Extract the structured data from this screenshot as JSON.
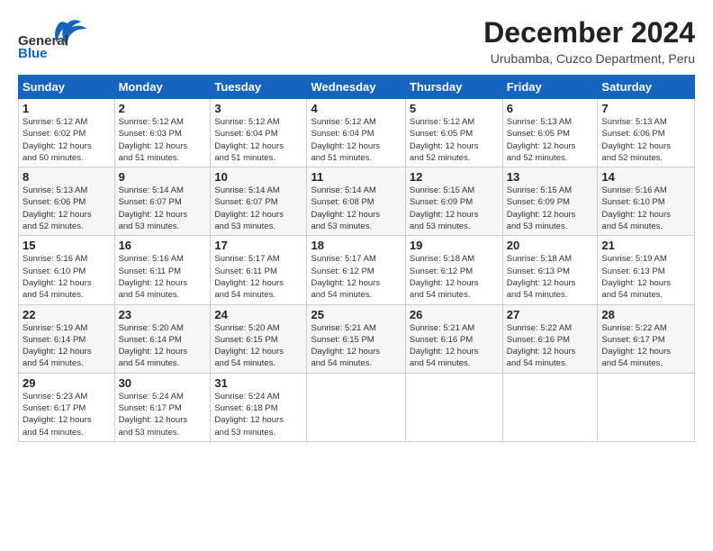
{
  "logo": {
    "general": "General",
    "blue": "Blue"
  },
  "header": {
    "title": "December 2024",
    "subtitle": "Urubamba, Cuzco Department, Peru"
  },
  "weekdays": [
    "Sunday",
    "Monday",
    "Tuesday",
    "Wednesday",
    "Thursday",
    "Friday",
    "Saturday"
  ],
  "weeks": [
    [
      {
        "day": 1,
        "info": "Sunrise: 5:12 AM\nSunset: 6:02 PM\nDaylight: 12 hours\nand 50 minutes."
      },
      {
        "day": 2,
        "info": "Sunrise: 5:12 AM\nSunset: 6:03 PM\nDaylight: 12 hours\nand 51 minutes."
      },
      {
        "day": 3,
        "info": "Sunrise: 5:12 AM\nSunset: 6:04 PM\nDaylight: 12 hours\nand 51 minutes."
      },
      {
        "day": 4,
        "info": "Sunrise: 5:12 AM\nSunset: 6:04 PM\nDaylight: 12 hours\nand 51 minutes."
      },
      {
        "day": 5,
        "info": "Sunrise: 5:12 AM\nSunset: 6:05 PM\nDaylight: 12 hours\nand 52 minutes."
      },
      {
        "day": 6,
        "info": "Sunrise: 5:13 AM\nSunset: 6:05 PM\nDaylight: 12 hours\nand 52 minutes."
      },
      {
        "day": 7,
        "info": "Sunrise: 5:13 AM\nSunset: 6:06 PM\nDaylight: 12 hours\nand 52 minutes."
      }
    ],
    [
      {
        "day": 8,
        "info": "Sunrise: 5:13 AM\nSunset: 6:06 PM\nDaylight: 12 hours\nand 52 minutes."
      },
      {
        "day": 9,
        "info": "Sunrise: 5:14 AM\nSunset: 6:07 PM\nDaylight: 12 hours\nand 53 minutes."
      },
      {
        "day": 10,
        "info": "Sunrise: 5:14 AM\nSunset: 6:07 PM\nDaylight: 12 hours\nand 53 minutes."
      },
      {
        "day": 11,
        "info": "Sunrise: 5:14 AM\nSunset: 6:08 PM\nDaylight: 12 hours\nand 53 minutes."
      },
      {
        "day": 12,
        "info": "Sunrise: 5:15 AM\nSunset: 6:09 PM\nDaylight: 12 hours\nand 53 minutes."
      },
      {
        "day": 13,
        "info": "Sunrise: 5:15 AM\nSunset: 6:09 PM\nDaylight: 12 hours\nand 53 minutes."
      },
      {
        "day": 14,
        "info": "Sunrise: 5:16 AM\nSunset: 6:10 PM\nDaylight: 12 hours\nand 54 minutes."
      }
    ],
    [
      {
        "day": 15,
        "info": "Sunrise: 5:16 AM\nSunset: 6:10 PM\nDaylight: 12 hours\nand 54 minutes."
      },
      {
        "day": 16,
        "info": "Sunrise: 5:16 AM\nSunset: 6:11 PM\nDaylight: 12 hours\nand 54 minutes."
      },
      {
        "day": 17,
        "info": "Sunrise: 5:17 AM\nSunset: 6:11 PM\nDaylight: 12 hours\nand 54 minutes."
      },
      {
        "day": 18,
        "info": "Sunrise: 5:17 AM\nSunset: 6:12 PM\nDaylight: 12 hours\nand 54 minutes."
      },
      {
        "day": 19,
        "info": "Sunrise: 5:18 AM\nSunset: 6:12 PM\nDaylight: 12 hours\nand 54 minutes."
      },
      {
        "day": 20,
        "info": "Sunrise: 5:18 AM\nSunset: 6:13 PM\nDaylight: 12 hours\nand 54 minutes."
      },
      {
        "day": 21,
        "info": "Sunrise: 5:19 AM\nSunset: 6:13 PM\nDaylight: 12 hours\nand 54 minutes."
      }
    ],
    [
      {
        "day": 22,
        "info": "Sunrise: 5:19 AM\nSunset: 6:14 PM\nDaylight: 12 hours\nand 54 minutes."
      },
      {
        "day": 23,
        "info": "Sunrise: 5:20 AM\nSunset: 6:14 PM\nDaylight: 12 hours\nand 54 minutes."
      },
      {
        "day": 24,
        "info": "Sunrise: 5:20 AM\nSunset: 6:15 PM\nDaylight: 12 hours\nand 54 minutes."
      },
      {
        "day": 25,
        "info": "Sunrise: 5:21 AM\nSunset: 6:15 PM\nDaylight: 12 hours\nand 54 minutes."
      },
      {
        "day": 26,
        "info": "Sunrise: 5:21 AM\nSunset: 6:16 PM\nDaylight: 12 hours\nand 54 minutes."
      },
      {
        "day": 27,
        "info": "Sunrise: 5:22 AM\nSunset: 6:16 PM\nDaylight: 12 hours\nand 54 minutes."
      },
      {
        "day": 28,
        "info": "Sunrise: 5:22 AM\nSunset: 6:17 PM\nDaylight: 12 hours\nand 54 minutes."
      }
    ],
    [
      {
        "day": 29,
        "info": "Sunrise: 5:23 AM\nSunset: 6:17 PM\nDaylight: 12 hours\nand 54 minutes."
      },
      {
        "day": 30,
        "info": "Sunrise: 5:24 AM\nSunset: 6:17 PM\nDaylight: 12 hours\nand 53 minutes."
      },
      {
        "day": 31,
        "info": "Sunrise: 5:24 AM\nSunset: 6:18 PM\nDaylight: 12 hours\nand 53 minutes."
      },
      null,
      null,
      null,
      null
    ]
  ]
}
